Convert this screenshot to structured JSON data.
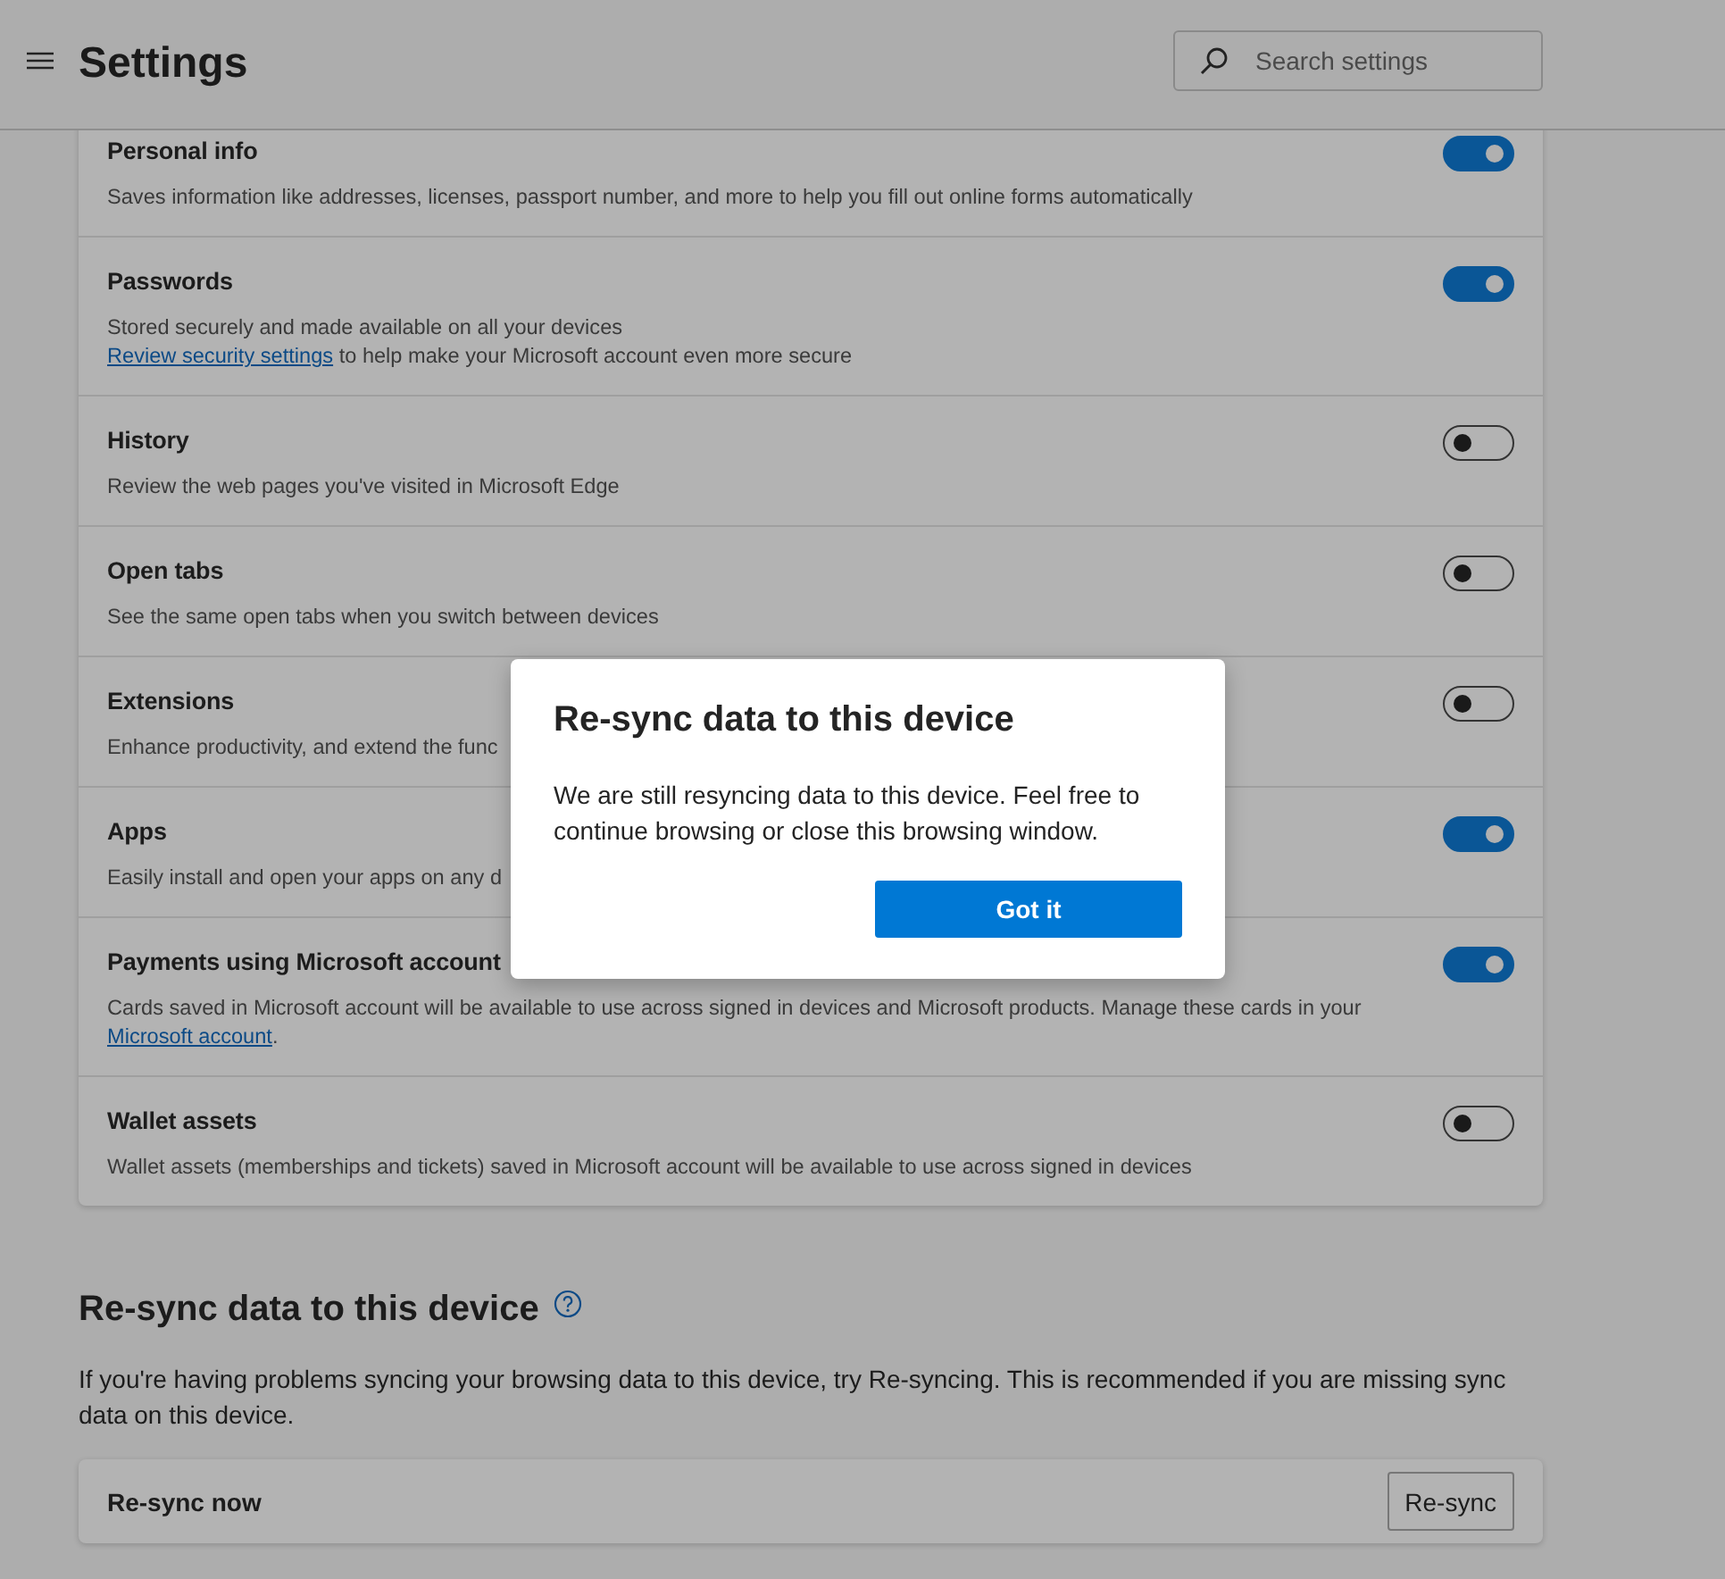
{
  "header": {
    "title": "Settings",
    "search": {
      "placeholder": "Search settings"
    }
  },
  "sync_items": [
    {
      "title": "Personal info",
      "on": true,
      "description": [
        [
          {
            "kind": "text",
            "text": "Saves information like addresses, licenses, passport number, and more to help you fill out online forms automatically"
          }
        ]
      ]
    },
    {
      "title": "Passwords",
      "on": true,
      "description": [
        [
          {
            "kind": "text",
            "text": "Stored securely and made available on all your devices"
          }
        ],
        [
          {
            "kind": "link",
            "text": "Review security settings"
          },
          {
            "kind": "text",
            "text": " to help make your Microsoft account even more secure"
          }
        ]
      ]
    },
    {
      "title": "History",
      "on": false,
      "description": [
        [
          {
            "kind": "text",
            "text": "Review the web pages you've visited in Microsoft Edge"
          }
        ]
      ]
    },
    {
      "title": "Open tabs",
      "on": false,
      "description": [
        [
          {
            "kind": "text",
            "text": "See the same open tabs when you switch between devices"
          }
        ]
      ]
    },
    {
      "title": "Extensions",
      "on": false,
      "description": [
        [
          {
            "kind": "text",
            "text": "Enhance productivity, and extend the func"
          }
        ]
      ]
    },
    {
      "title": "Apps",
      "on": true,
      "description": [
        [
          {
            "kind": "text",
            "text": "Easily install and open your apps on any d"
          }
        ]
      ]
    },
    {
      "title": "Payments using Microsoft account",
      "on": true,
      "description": [
        [
          {
            "kind": "text",
            "text": "Cards saved in Microsoft account will be available to use across signed in devices and Microsoft products. Manage these cards in your "
          },
          {
            "kind": "link",
            "text": "Microsoft account"
          },
          {
            "kind": "text",
            "text": "."
          }
        ]
      ]
    },
    {
      "title": "Wallet assets",
      "on": false,
      "description": [
        [
          {
            "kind": "text",
            "text": "Wallet assets (memberships and tickets) saved in Microsoft account will be available to use across signed in devices"
          }
        ]
      ]
    }
  ],
  "resync_section": {
    "title": "Re-sync data to this device",
    "description": "If you're having problems syncing your browsing data to this device, try Re-syncing. This is recommended if you are missing sync data on this device.",
    "row_label": "Re-sync now",
    "button": "Re-sync"
  },
  "dialog": {
    "title": "Re-sync data to this device",
    "message": "We are still resyncing data to this device. Feel free to continue browsing or close this browsing window.",
    "button": "Got it"
  }
}
